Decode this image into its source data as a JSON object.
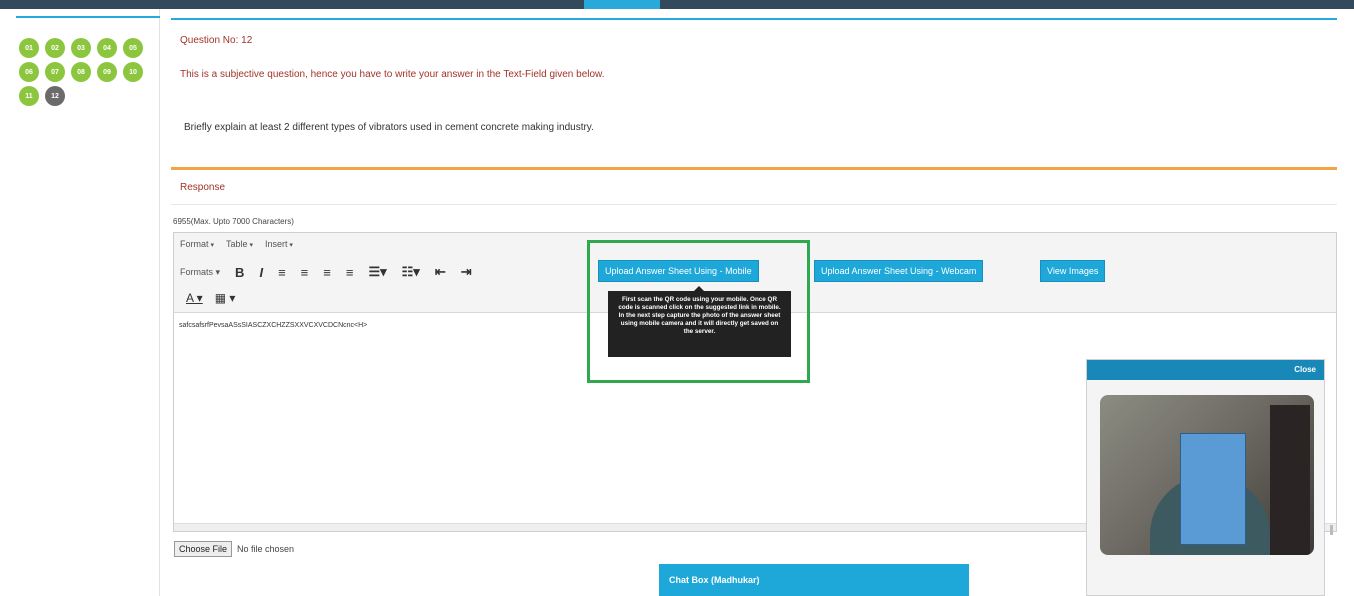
{
  "sidebar": {
    "questions": [
      "01",
      "02",
      "03",
      "04",
      "05",
      "06",
      "07",
      "08",
      "09",
      "10",
      "11",
      "12"
    ],
    "current": "12",
    "answered_color": "#8cc63f",
    "current_color": "#6b6b6b"
  },
  "question": {
    "number_label": "Question No: 12",
    "instruction": "This is a subjective question, hence you have to write your answer in the Text-Field given below.",
    "text": "Briefly explain at least 2 different types of vibrators used in cement concrete making industry."
  },
  "response": {
    "label": "Response",
    "counter": "6955(Max. Upto 7000 Characters)"
  },
  "editor": {
    "menu": [
      "Format",
      "Table",
      "Insert"
    ],
    "formats_label": "Formats",
    "content": "safcsafsrfPevsaASsSIASCZXCHZZSXXVCXVCDCNcnc<H>",
    "upload_mobile_label": "Upload Answer Sheet Using - Mobile",
    "upload_webcam_label": "Upload Answer Sheet Using - Webcam",
    "view_images_label": "View Images",
    "button_color": "#1ea8d9"
  },
  "tooltip": {
    "text": "First scan the QR code using your mobile. Once QR code is scanned click on the suggested link in mobile. In the next step capture the photo of the answer sheet using mobile camera and it will directly get saved on the server."
  },
  "file": {
    "choose_label": "Choose File",
    "status": "No file chosen"
  },
  "chat": {
    "title": "Chat Box (Madhukar)"
  },
  "webcam": {
    "close_label": "Close"
  },
  "colors": {
    "accent": "#29a8dc",
    "highlight": "#2fa84f",
    "warning_line": "#f2a548",
    "red_text": "#a0342a"
  }
}
